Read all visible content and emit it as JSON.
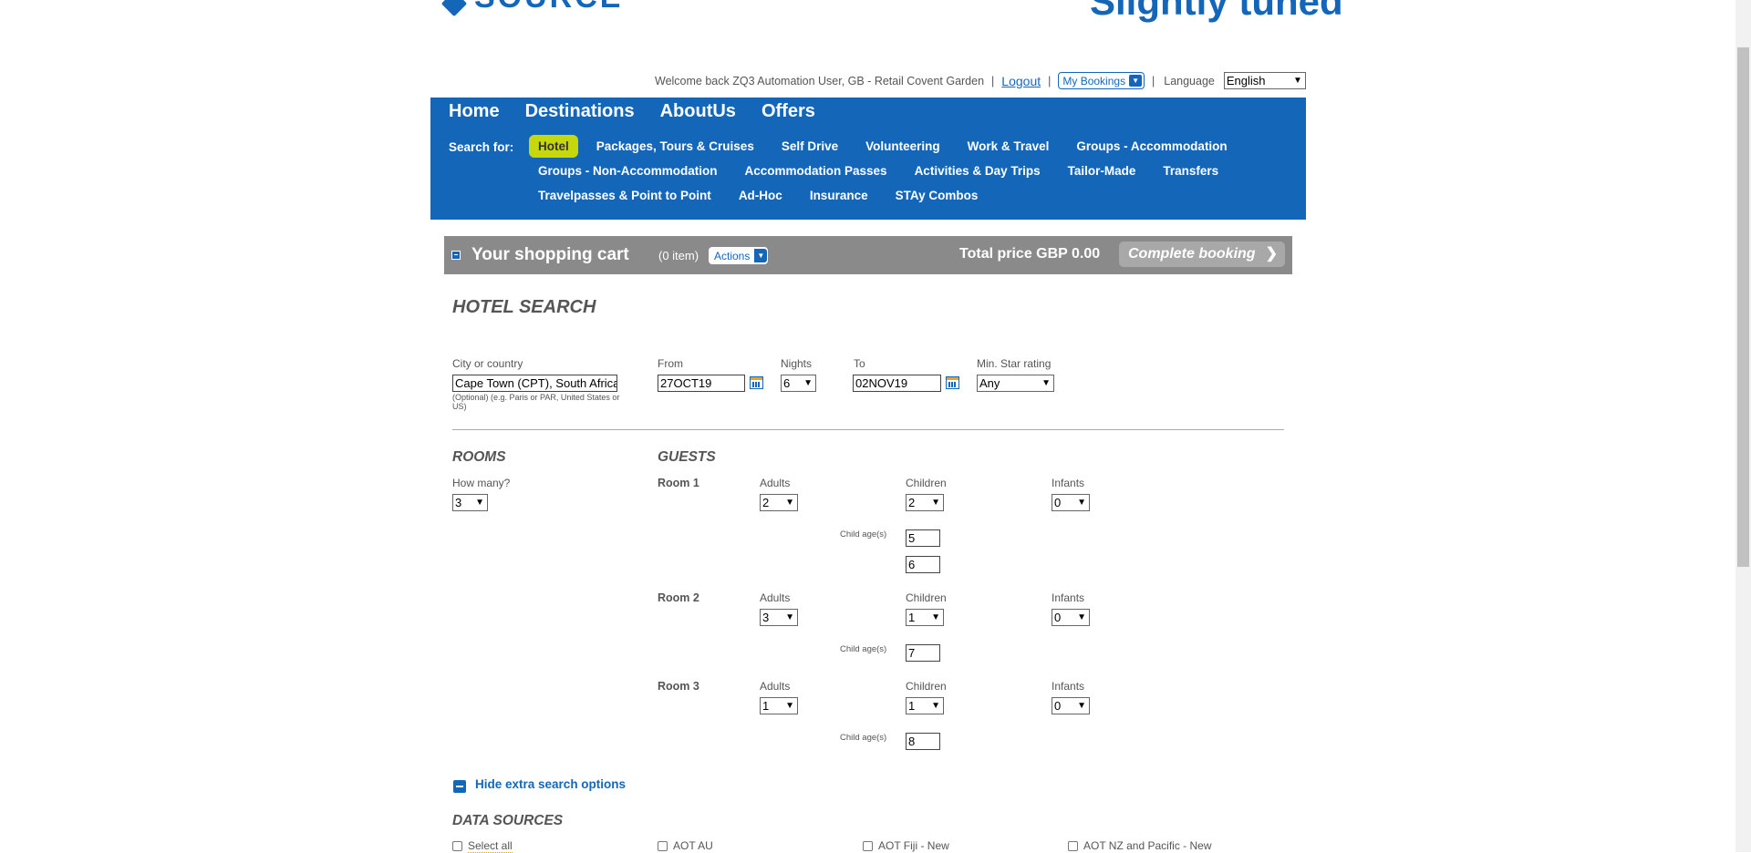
{
  "header": {
    "logo_text": "SOURCE",
    "tagline": "Slightly tuned",
    "welcome": "Welcome back ZQ3 Automation User, GB - Retail Covent Garden",
    "logout": "Logout",
    "my_bookings": "My Bookings",
    "language_label": "Language",
    "language_value": "English"
  },
  "nav": {
    "main": [
      "Home",
      "Destinations",
      "AboutUs",
      "Offers"
    ],
    "search_for_label": "Search for:",
    "rows": [
      [
        "Hotel",
        "Packages, Tours & Cruises",
        "Self Drive",
        "Volunteering",
        "Work & Travel",
        "Groups - Accommodation"
      ],
      [
        "Groups - Non-Accommodation",
        "Accommodation Passes",
        "Activities & Day Trips",
        "Tailor-Made",
        "Transfers"
      ],
      [
        "Travelpasses & Point to Point",
        "Ad-Hoc",
        "Insurance",
        "STAy Combos"
      ]
    ],
    "active": "Hotel"
  },
  "cart": {
    "title": "Your shopping cart",
    "count": "(0 item)",
    "actions": "Actions",
    "total": "Total price GBP 0.00",
    "complete": "Complete booking"
  },
  "search": {
    "title": "HOTEL SEARCH",
    "city_label": "City or country",
    "city_value": "Cape Town (CPT), South Africa",
    "city_hint": "(Optional) (e.g. Paris or PAR, United States or US)",
    "from_label": "From",
    "from_value": "27OCT19",
    "nights_label": "Nights",
    "nights_value": "6",
    "to_label": "To",
    "to_value": "02NOV19",
    "star_label": "Min. Star rating",
    "star_value": "Any"
  },
  "rooms": {
    "title": "ROOMS",
    "how_many_label": "How many?",
    "how_many_value": "3"
  },
  "guests": {
    "title": "GUESTS",
    "adults_label": "Adults",
    "children_label": "Children",
    "infants_label": "Infants",
    "child_ages_label": "Child age(s)",
    "rooms": [
      {
        "label": "Room 1",
        "adults": "2",
        "children": "2",
        "infants": "0",
        "ages": [
          "5",
          "6"
        ]
      },
      {
        "label": "Room 2",
        "adults": "3",
        "children": "1",
        "infants": "0",
        "ages": [
          "7"
        ]
      },
      {
        "label": "Room 3",
        "adults": "1",
        "children": "1",
        "infants": "0",
        "ages": [
          "8"
        ]
      }
    ]
  },
  "extra": {
    "hide_label": "Hide extra search options",
    "data_sources_title": "DATA SOURCES",
    "sources": [
      "Select all",
      "AOT AU",
      "AOT Fiji - New",
      "AOT NZ and Pacific - New"
    ]
  },
  "colors": {
    "brand_blue": "#1467b8",
    "active_tab": "#c6d70c",
    "cart_bg": "#8a8a8a"
  }
}
